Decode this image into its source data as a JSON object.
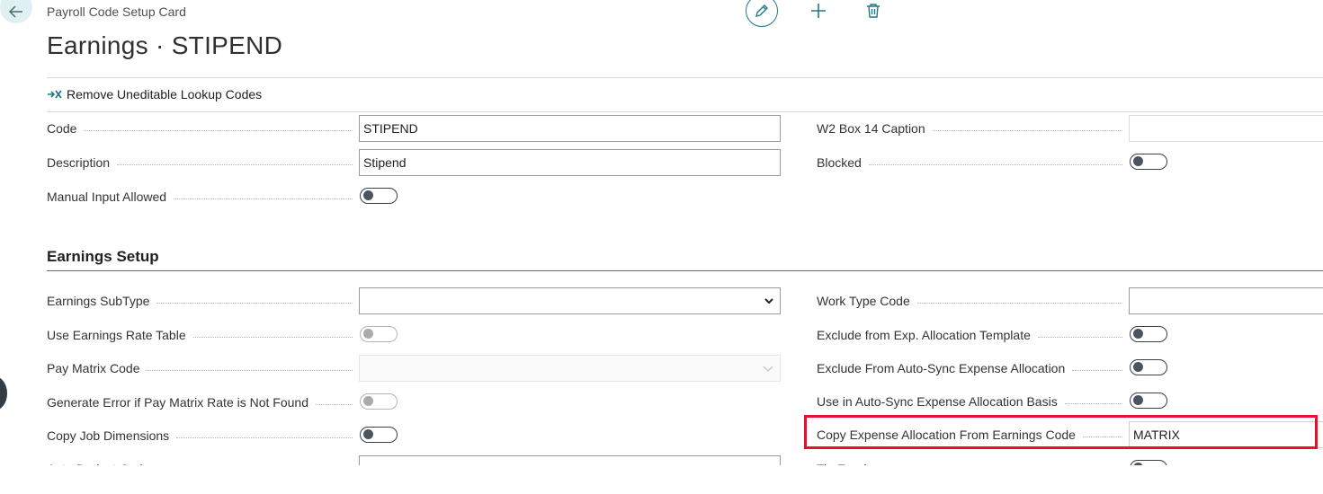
{
  "header": {
    "breadcrumb": "Payroll Code Setup Card",
    "title": "Earnings · STIPEND"
  },
  "actions": {
    "remove_uneditable": "Remove Uneditable Lookup Codes"
  },
  "general": {
    "code_label": "Code",
    "code_value": "STIPEND",
    "description_label": "Description",
    "description_value": "Stipend",
    "manual_input_label": "Manual Input Allowed",
    "w2_box14_label": "W2 Box 14 Caption",
    "w2_box14_value": "",
    "blocked_label": "Blocked"
  },
  "earnings_setup": {
    "section_title": "Earnings Setup",
    "subtype_label": "Earnings SubType",
    "subtype_value": "",
    "rate_table_label": "Use Earnings Rate Table",
    "pay_matrix_label": "Pay Matrix Code",
    "pay_matrix_value": "",
    "generate_error_label": "Generate Error if Pay Matrix Rate is Not Found",
    "copy_job_dims_label": "Copy Job Dimensions",
    "auto_deduct_label": "Auto Deduct Code",
    "work_type_label": "Work Type Code",
    "work_type_value": "",
    "exclude_exp_alloc_label": "Exclude from Exp. Allocation Template",
    "exclude_autosync_label": "Exclude From Auto-Sync Expense Allocation",
    "use_autosync_label": "Use in Auto-Sync Expense Allocation Basis",
    "copy_exp_alloc_label": "Copy Expense Allocation From Earnings Code",
    "copy_exp_alloc_value": "MATRIX",
    "tip_earnings_label": "Tip Earnings"
  },
  "colors": {
    "accent": "#1f7a85",
    "highlight": "#e8112d"
  },
  "icons": {
    "back": "arrow-left-icon",
    "edit": "pencil-icon",
    "add": "plus-icon",
    "delete": "trash-icon",
    "remove_lookup": "remove-lookup-icon"
  }
}
